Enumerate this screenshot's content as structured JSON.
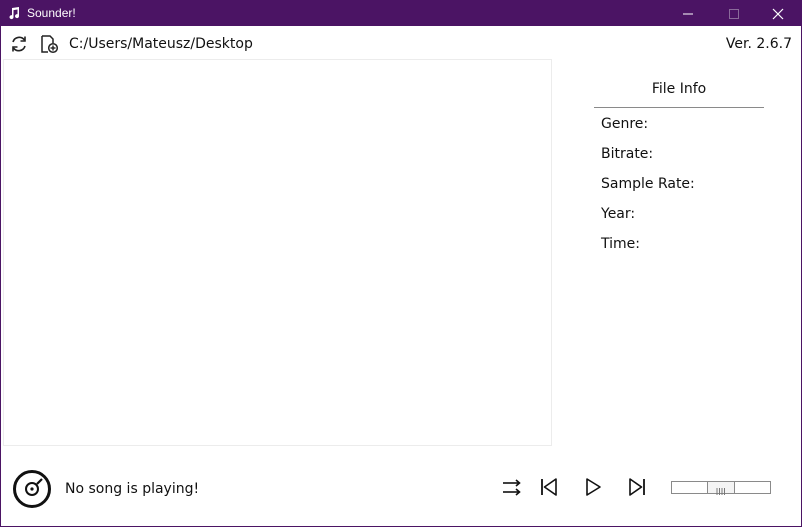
{
  "window": {
    "title": "Sounder!",
    "icons": {
      "app": "music-note-icon",
      "minimize": "minimize-icon",
      "maximize": "maximize-icon",
      "close": "close-icon"
    },
    "accent_color": "#4b1464"
  },
  "toolbar": {
    "path": "C:/Users/Mateusz/Desktop",
    "version": "Ver. 2.6.7",
    "icons": {
      "refresh": "refresh-icon",
      "add": "add-file-icon"
    }
  },
  "song_list": {
    "items": []
  },
  "file_info": {
    "title": "File Info",
    "fields": [
      {
        "label": "Genre:",
        "value": ""
      },
      {
        "label": "Bitrate:",
        "value": ""
      },
      {
        "label": "Sample Rate:",
        "value": ""
      },
      {
        "label": "Year:",
        "value": ""
      },
      {
        "label": "Time:",
        "value": ""
      }
    ]
  },
  "player": {
    "status": "No song is playing!",
    "icons": {
      "disc": "vinyl-disc-icon",
      "shuffle": "shuffle-icon",
      "previous": "skip-previous-icon",
      "play": "play-icon",
      "next": "skip-next-icon"
    },
    "volume": 0.5
  }
}
